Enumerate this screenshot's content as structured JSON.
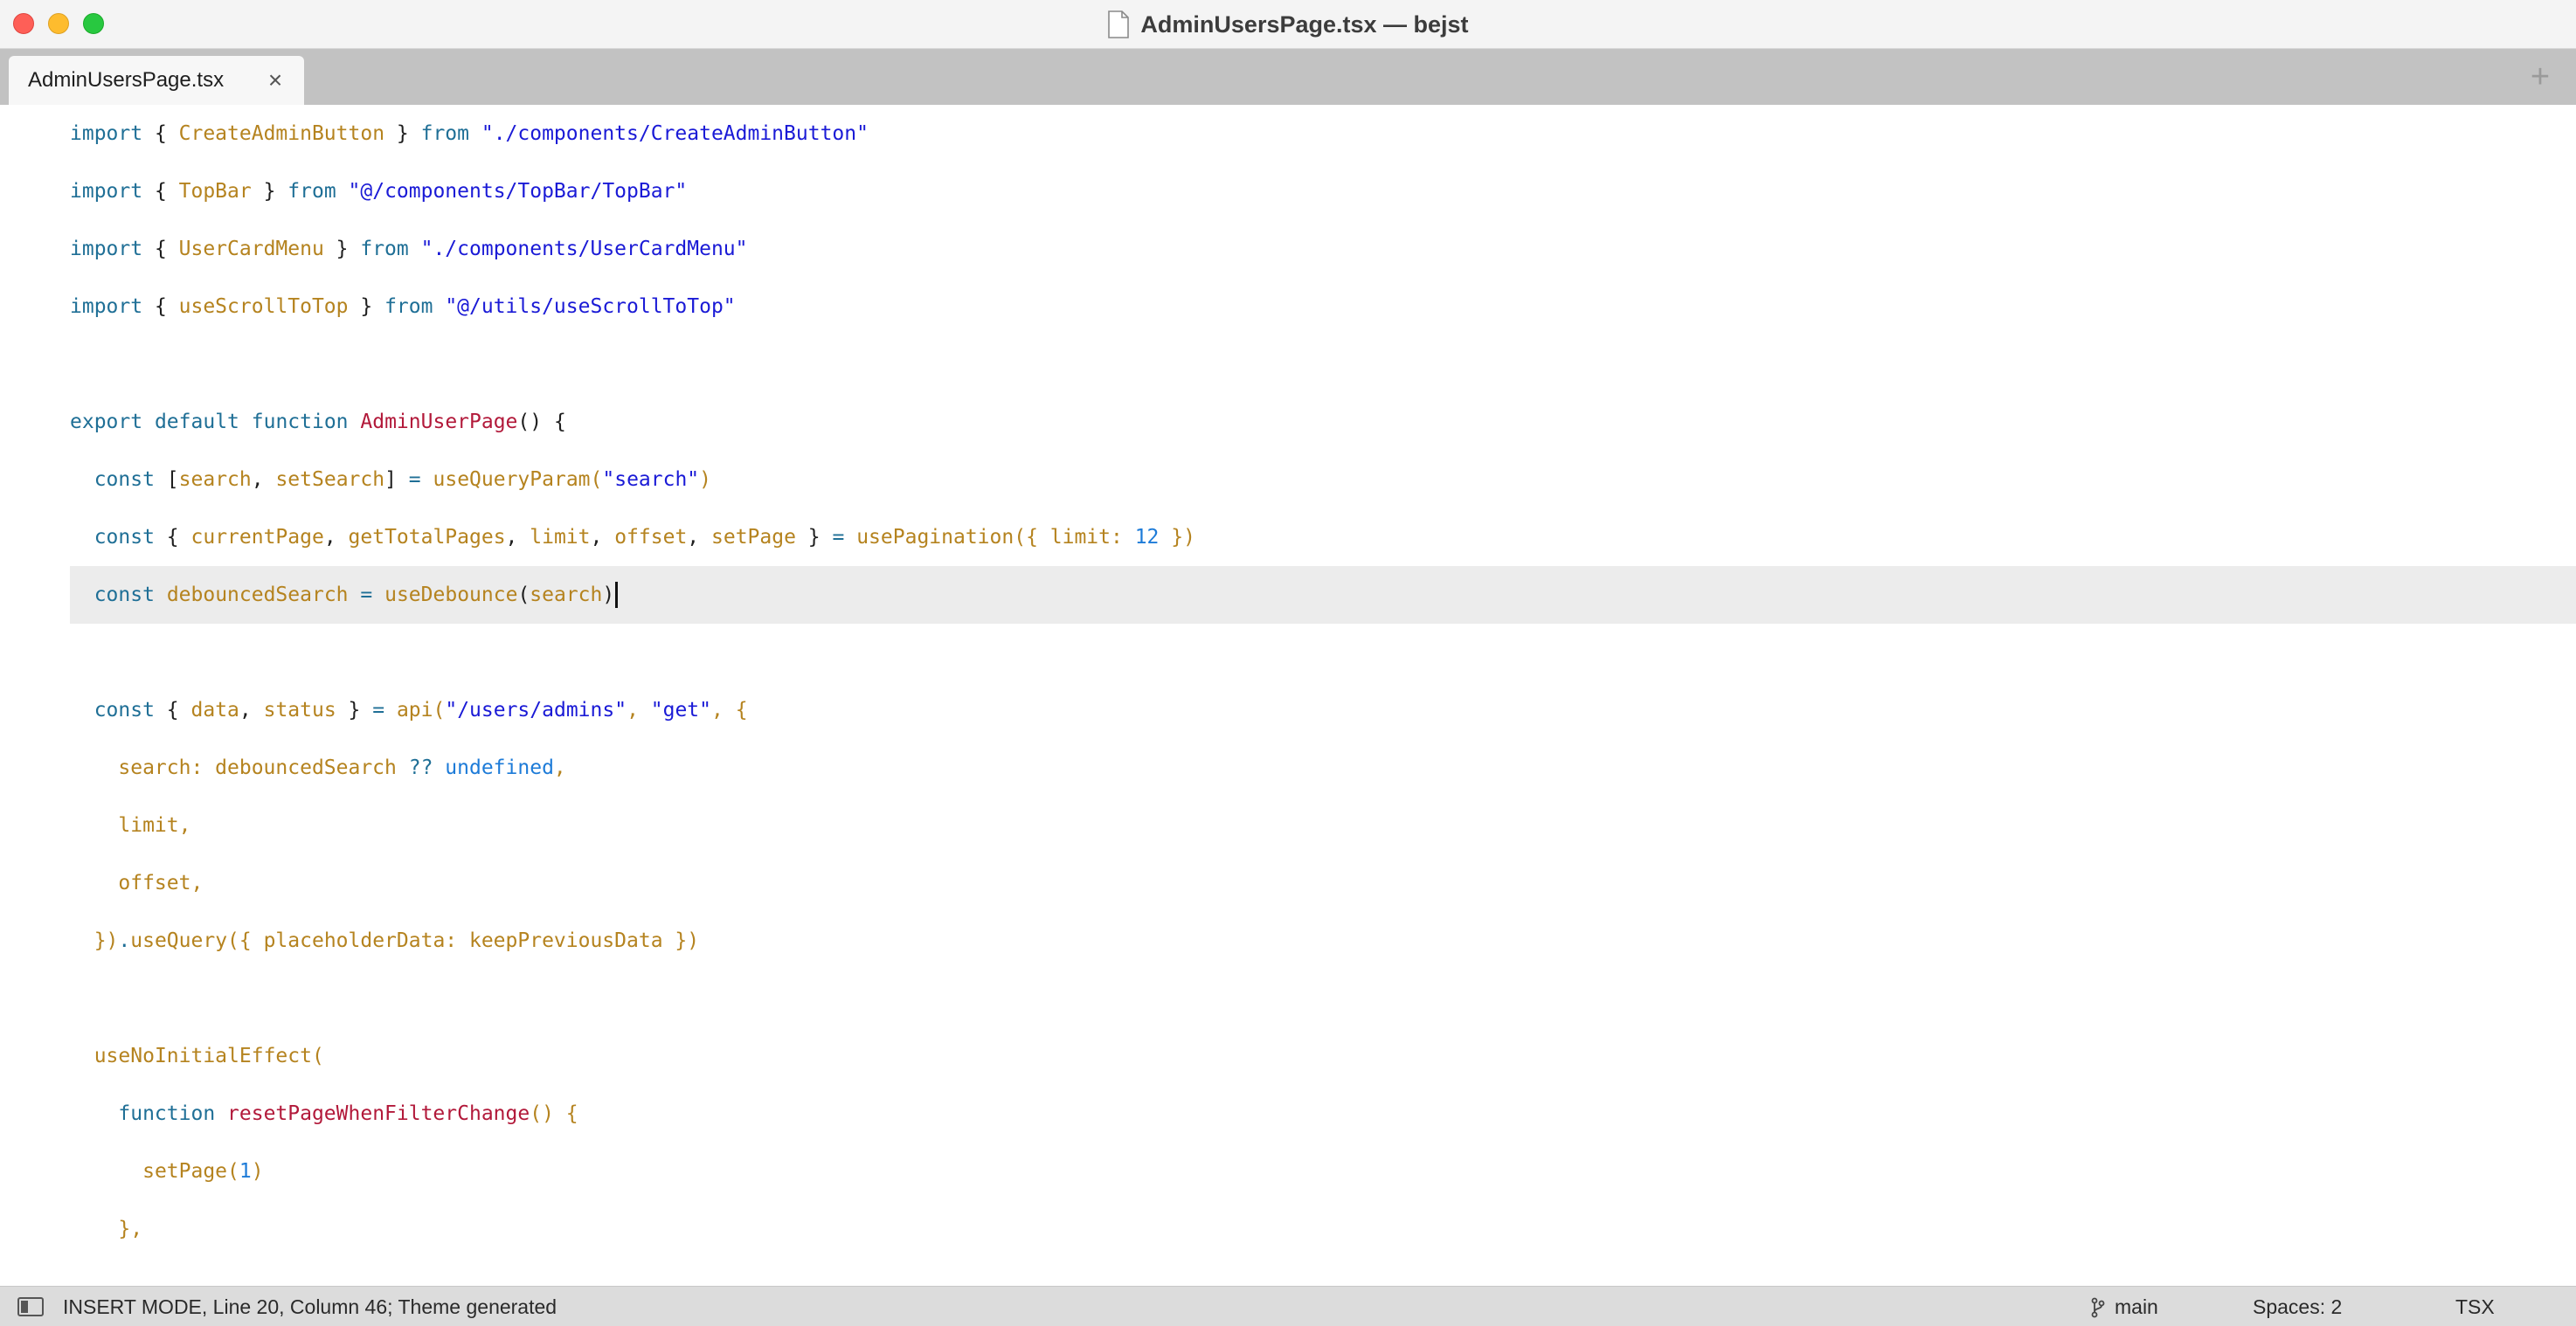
{
  "window": {
    "title": "AdminUsersPage.tsx — bejst"
  },
  "tabs": [
    {
      "label": "AdminUsersPage.tsx",
      "active": true
    }
  ],
  "tab_close_glyph": "×",
  "tab_add_glyph": "+",
  "colors": {
    "keyword": "#1f6f96",
    "identifier": "#b5831f",
    "string": "#1a1ad6",
    "function": "#b2193a",
    "number": "#1d7bd8"
  },
  "editor": {
    "current_line": 9,
    "lines": [
      [
        [
          "k",
          "import"
        ],
        [
          "p",
          " { "
        ],
        [
          "i",
          "CreateAdminButton"
        ],
        [
          "p",
          " } "
        ],
        [
          "k",
          "from"
        ],
        [
          "p",
          " "
        ],
        [
          "s",
          "\"./components/CreateAdminButton\""
        ]
      ],
      [
        [
          "k",
          "import"
        ],
        [
          "p",
          " { "
        ],
        [
          "i",
          "TopBar"
        ],
        [
          "p",
          " } "
        ],
        [
          "k",
          "from"
        ],
        [
          "p",
          " "
        ],
        [
          "s",
          "\"@/components/TopBar/TopBar\""
        ]
      ],
      [
        [
          "k",
          "import"
        ],
        [
          "p",
          " { "
        ],
        [
          "i",
          "UserCardMenu"
        ],
        [
          "p",
          " } "
        ],
        [
          "k",
          "from"
        ],
        [
          "p",
          " "
        ],
        [
          "s",
          "\"./components/UserCardMenu\""
        ]
      ],
      [
        [
          "k",
          "import"
        ],
        [
          "p",
          " { "
        ],
        [
          "i",
          "useScrollToTop"
        ],
        [
          "p",
          " } "
        ],
        [
          "k",
          "from"
        ],
        [
          "p",
          " "
        ],
        [
          "s",
          "\"@/utils/useScrollToTop\""
        ]
      ],
      [],
      [
        [
          "k",
          "export"
        ],
        [
          "p",
          " "
        ],
        [
          "k",
          "default"
        ],
        [
          "p",
          " "
        ],
        [
          "k",
          "function"
        ],
        [
          "p",
          " "
        ],
        [
          "f",
          "AdminUserPage"
        ],
        [
          "p",
          "() {"
        ]
      ],
      [
        [
          "p",
          "  "
        ],
        [
          "k",
          "const"
        ],
        [
          "p",
          " ["
        ],
        [
          "i",
          "search"
        ],
        [
          "p",
          ", "
        ],
        [
          "i",
          "setSearch"
        ],
        [
          "p",
          "] "
        ],
        [
          "k",
          "="
        ],
        [
          "p",
          " "
        ],
        [
          "i",
          "useQueryParam"
        ],
        [
          "i",
          "("
        ],
        [
          "s",
          "\"search\""
        ],
        [
          "i",
          ")"
        ]
      ],
      [
        [
          "p",
          "  "
        ],
        [
          "k",
          "const"
        ],
        [
          "p",
          " { "
        ],
        [
          "i",
          "currentPage"
        ],
        [
          "p",
          ", "
        ],
        [
          "i",
          "getTotalPages"
        ],
        [
          "p",
          ", "
        ],
        [
          "i",
          "limit"
        ],
        [
          "p",
          ", "
        ],
        [
          "i",
          "offset"
        ],
        [
          "p",
          ", "
        ],
        [
          "i",
          "setPage"
        ],
        [
          "p",
          " } "
        ],
        [
          "k",
          "="
        ],
        [
          "p",
          " "
        ],
        [
          "i",
          "usePagination({ limit: "
        ],
        [
          "n",
          "12"
        ],
        [
          "i",
          " })"
        ]
      ],
      [
        [
          "p",
          "  "
        ],
        [
          "k",
          "const"
        ],
        [
          "p",
          " "
        ],
        [
          "i",
          "debouncedSearch"
        ],
        [
          "p",
          " "
        ],
        [
          "k",
          "="
        ],
        [
          "p",
          " "
        ],
        [
          "i",
          "useDebounce"
        ],
        [
          "p",
          "("
        ],
        [
          "i",
          "search"
        ],
        [
          "p",
          ")"
        ]
      ],
      [],
      [
        [
          "p",
          "  "
        ],
        [
          "k",
          "const"
        ],
        [
          "p",
          " { "
        ],
        [
          "i",
          "data"
        ],
        [
          "p",
          ", "
        ],
        [
          "i",
          "status"
        ],
        [
          "p",
          " } "
        ],
        [
          "k",
          "="
        ],
        [
          "p",
          " "
        ],
        [
          "i",
          "api("
        ],
        [
          "s",
          "\"/users/admins\""
        ],
        [
          "i",
          ", "
        ],
        [
          "s",
          "\"get\""
        ],
        [
          "i",
          ", {"
        ]
      ],
      [
        [
          "p",
          "    "
        ],
        [
          "i",
          "search: debouncedSearch "
        ],
        [
          "k",
          "??"
        ],
        [
          "p",
          " "
        ],
        [
          "n",
          "undefined"
        ],
        [
          "i",
          ","
        ]
      ],
      [
        [
          "p",
          "    "
        ],
        [
          "i",
          "limit,"
        ]
      ],
      [
        [
          "p",
          "    "
        ],
        [
          "i",
          "offset,"
        ]
      ],
      [
        [
          "p",
          "  "
        ],
        [
          "i",
          "})"
        ],
        [
          "k",
          "."
        ],
        [
          "i",
          "useQuery({ placeholderData: keepPreviousData })"
        ]
      ],
      [],
      [
        [
          "p",
          "  "
        ],
        [
          "i",
          "useNoInitialEffect("
        ]
      ],
      [
        [
          "p",
          "    "
        ],
        [
          "k",
          "function"
        ],
        [
          "p",
          " "
        ],
        [
          "f",
          "resetPageWhenFilterChange"
        ],
        [
          "i",
          "() {"
        ]
      ],
      [
        [
          "p",
          "      "
        ],
        [
          "i",
          "setPage("
        ],
        [
          "n",
          "1"
        ],
        [
          "i",
          ")"
        ]
      ],
      [
        [
          "p",
          "    "
        ],
        [
          "i",
          "},"
        ]
      ]
    ]
  },
  "statusbar": {
    "mode": "INSERT MODE, Line 20, Column 46; Theme generated",
    "branch": "main",
    "indent": "Spaces: 2",
    "syntax": "TSX"
  }
}
